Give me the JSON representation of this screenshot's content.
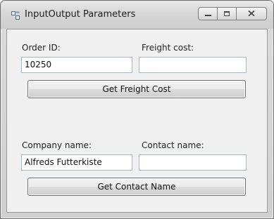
{
  "window": {
    "title": "InputOutput Parameters"
  },
  "form": {
    "order_id_label": "Order ID:",
    "order_id_value": "10250",
    "freight_cost_label": "Freight cost:",
    "freight_cost_value": "",
    "get_freight_button": "Get Freight Cost",
    "company_name_label": "Company name:",
    "company_name_value": "Alfreds Futterkiste",
    "contact_name_label": "Contact name:",
    "contact_name_value": "",
    "get_contact_button": "Get Contact Name"
  },
  "icons": {
    "app": "form-window-icon",
    "minimize": "minimize-icon",
    "maximize": "maximize-icon",
    "close": "close-icon"
  }
}
